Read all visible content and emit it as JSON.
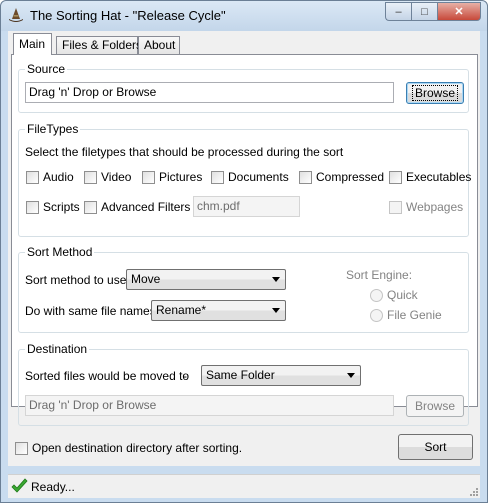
{
  "window": {
    "title": "The Sorting Hat - \"Release Cycle\"",
    "minimize_glyph": "–",
    "maximize_glyph": "□",
    "close_glyph": "✕"
  },
  "tabs": [
    {
      "label": "Main",
      "active": true
    },
    {
      "label": "Files & Folders*",
      "active": false
    },
    {
      "label": "About",
      "active": false
    }
  ],
  "source": {
    "group_title": "Source",
    "input_value": "Drag 'n' Drop or Browse",
    "browse_label": "Browse"
  },
  "filetypes": {
    "group_title": "FileTypes",
    "instructions": "Select the filetypes that should be processed during the sort",
    "checkboxes": [
      {
        "label": "Audio",
        "checked": false,
        "enabled": true
      },
      {
        "label": "Video",
        "checked": false,
        "enabled": true
      },
      {
        "label": "Pictures",
        "checked": false,
        "enabled": true
      },
      {
        "label": "Documents",
        "checked": false,
        "enabled": true
      },
      {
        "label": "Compressed",
        "checked": false,
        "enabled": true
      },
      {
        "label": "Executables",
        "checked": false,
        "enabled": true
      },
      {
        "label": "Scripts",
        "checked": false,
        "enabled": true
      },
      {
        "label": "Advanced Filters -",
        "checked": false,
        "enabled": true
      },
      {
        "label": "Webpages",
        "checked": false,
        "enabled": false
      }
    ],
    "filter_value": "chm.pdf"
  },
  "sort_method": {
    "group_title": "Sort Method",
    "method_label": "Sort method to use -",
    "method_value": "Move",
    "same_name_label": "Do with same file names -",
    "same_name_value": "Rename*",
    "engine_label": "Sort Engine:",
    "engine_options": [
      {
        "label": "Quick",
        "selected": false
      },
      {
        "label": "File Genie",
        "selected": false
      }
    ]
  },
  "destination": {
    "group_title": "Destination",
    "moved_to_label": "Sorted files would be moved to",
    "dash": "-",
    "folder_value": "Same Folder",
    "input_value": "Drag 'n' Drop or Browse",
    "browse_label": "Browse"
  },
  "bottom": {
    "open_dest_label": "Open destination directory after sorting.",
    "open_dest_checked": false,
    "sort_label": "Sort"
  },
  "status": {
    "text": "Ready...",
    "icon": "green-checkmark-icon"
  },
  "colors": {
    "accent_green": "#3aa832",
    "window_frame": "#c9dcef"
  }
}
